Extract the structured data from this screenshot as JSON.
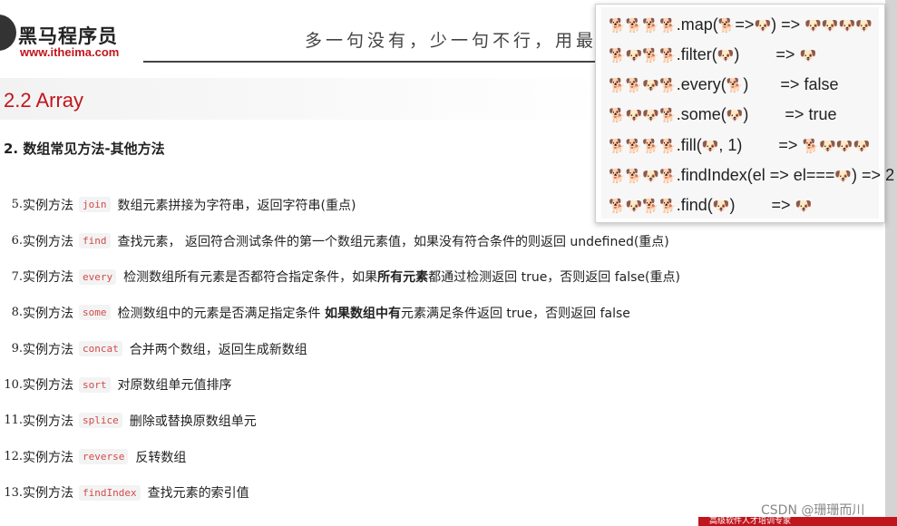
{
  "header": {
    "logo_name": "黑马程序员",
    "logo_url": "www.itheima.com",
    "slogan": "多一句没有，少一句不行，用最"
  },
  "section": {
    "title": "2.2 Array",
    "subtitle": "2. 数组常见方法-其他方法"
  },
  "methods": [
    {
      "num": "5.",
      "lead": "实例方法",
      "code": "join",
      "desc": "数组元素拼接为字符串，返回字符串(重点)"
    },
    {
      "num": "6.",
      "lead": "实例方法",
      "code": "find",
      "desc": "查找元素， 返回符合测试条件的第一个数组元素值，如果没有符合条件的则返回 undefined(重点)"
    },
    {
      "num": "7.",
      "lead": "实例方法",
      "code": "every",
      "desc_pre": "检测数组所有元素是否都符合指定条件，如果",
      "desc_bold": "所有元素",
      "desc_post": "都通过检测返回 true，否则返回 false(重点)"
    },
    {
      "num": "8.",
      "lead": "实例方法",
      "code": "some",
      "desc_pre": "检测数组中的元素是否满足指定条件  ",
      "desc_bold": "如果数组中有",
      "desc_post": "元素满足条件返回 true，否则返回 false"
    },
    {
      "num": "9.",
      "lead": "实例方法",
      "code": "concat",
      "desc": "合并两个数组，返回生成新数组"
    },
    {
      "num": "10.",
      "lead": "实例方法",
      "code": "sort",
      "desc": "对原数组单元值排序"
    },
    {
      "num": "11.",
      "lead": "实例方法",
      "code": "splice",
      "desc": "删除或替换原数组单元"
    },
    {
      "num": "12.",
      "lead": "实例方法",
      "code": "reverse",
      "desc": "反转数组"
    },
    {
      "num": "13.",
      "lead": "实例方法",
      "code": "findIndex",
      "desc": "查找元素的索引值"
    }
  ],
  "popup": {
    "lines": [
      {
        "pre": "🐕🐕🐕🐕",
        "mid": ".map(",
        "e1": "🐕",
        "op": "=>",
        "e2": "🐶",
        "post": ") => ",
        "res": "🐶🐶🐶🐶"
      },
      {
        "pre": "🐕🐶🐕🐕",
        "mid": ".filter(",
        "e1": "🐶",
        "op": "",
        "e2": "",
        "post": ")        => ",
        "res": "🐶"
      },
      {
        "pre": "🐕🐕🐶🐕",
        "mid": ".every(",
        "e1": "🐕",
        "op": "",
        "e2": "",
        "post": ")       => false",
        "res": ""
      },
      {
        "pre": "🐕🐶🐶🐕",
        "mid": ".some(",
        "e1": "🐶",
        "op": "",
        "e2": "",
        "post": ")        => true",
        "res": ""
      },
      {
        "pre": "🐕🐕🐕🐕",
        "mid": ".fill(",
        "e1": "🐶",
        "op": "",
        "e2": "",
        "post": ", 1)        => ",
        "res": "🐕🐶🐶🐶"
      },
      {
        "pre": "🐕🐕🐶🐕",
        "mid": ".findIndex(el => el===",
        "e1": "🐶",
        "op": "",
        "e2": "",
        "post": ") => 2",
        "res": ""
      },
      {
        "pre": "🐕🐶🐕🐕",
        "mid": ".find(",
        "e1": "🐶",
        "op": "",
        "e2": "",
        "post": ")        => ",
        "res": "🐶"
      }
    ]
  },
  "watermark": "CSDN @珊珊而川",
  "bottom_band_text": "高级软件人才培训专家"
}
